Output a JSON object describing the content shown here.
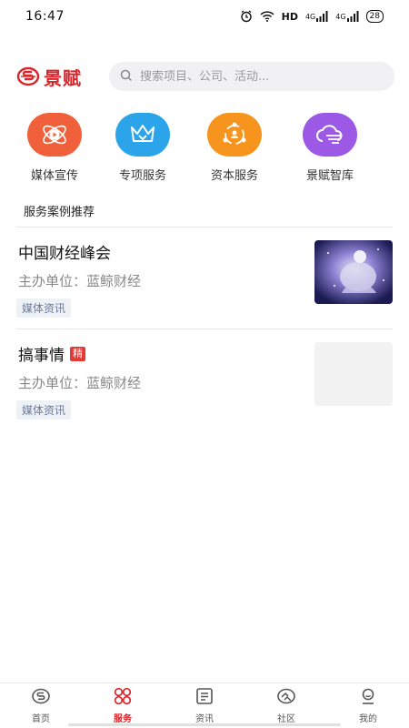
{
  "status_bar": {
    "time": "16:47",
    "network": "HD",
    "signal1": "4G",
    "signal2": "4G",
    "battery": "28"
  },
  "header": {
    "logo_text": "景赋",
    "search_placeholder": "搜索项目、公司、活动..."
  },
  "categories": [
    {
      "label": "媒体宣传",
      "icon": "media-play-icon",
      "color": "#f0603a"
    },
    {
      "label": "专项服务",
      "icon": "crown-icon",
      "color": "#2ba4ea"
    },
    {
      "label": "资本服务",
      "icon": "share-network-icon",
      "color": "#f7941d"
    },
    {
      "label": "景赋智库",
      "icon": "cloud-icon",
      "color": "#9b59e6"
    }
  ],
  "section": {
    "title": "服务案例推荐"
  },
  "cases": [
    {
      "title": "中国财经峰会",
      "organizer": "主办单位：蓝鲸财经",
      "tag": "媒体资讯",
      "badge": ""
    },
    {
      "title": "搞事情",
      "organizer": "主办单位：蓝鲸财经",
      "tag": "媒体资讯",
      "badge": "精"
    }
  ],
  "bottom_nav": [
    {
      "label": "首页",
      "icon": "home-logo-icon",
      "active": false
    },
    {
      "label": "服务",
      "icon": "grid-icon",
      "active": true
    },
    {
      "label": "资讯",
      "icon": "news-icon",
      "active": false
    },
    {
      "label": "社区",
      "icon": "community-icon",
      "active": false
    },
    {
      "label": "我的",
      "icon": "profile-icon",
      "active": false
    }
  ],
  "colors": {
    "brand": "#d8262b",
    "tag_bg": "#eef1f6",
    "tag_text": "#6b7a99"
  }
}
